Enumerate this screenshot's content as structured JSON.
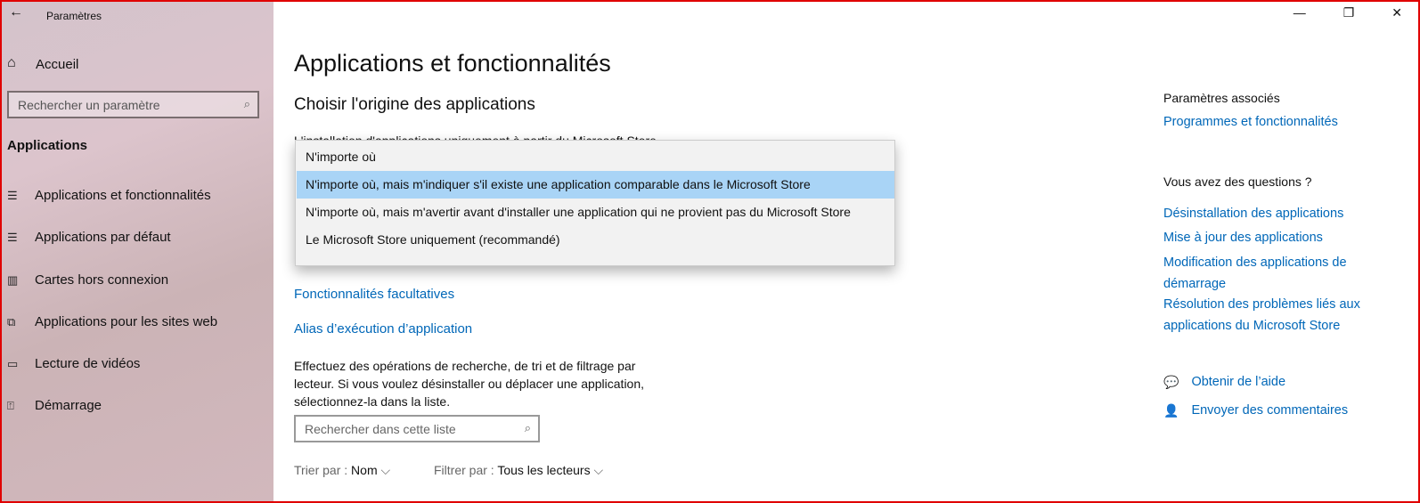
{
  "window": {
    "title": "Paramètres",
    "minimize": "—",
    "restore": "❐",
    "close": "✕"
  },
  "sidebar": {
    "home": "Accueil",
    "search_placeholder": "Rechercher un paramètre",
    "section": "Applications",
    "items": [
      {
        "label": "Applications et fonctionnalités",
        "icon": "apps-features-icon"
      },
      {
        "label": "Applications par défaut",
        "icon": "default-apps-icon"
      },
      {
        "label": "Cartes hors connexion",
        "icon": "offline-maps-icon"
      },
      {
        "label": "Applications pour les sites web",
        "icon": "apps-websites-icon"
      },
      {
        "label": "Lecture de vidéos",
        "icon": "video-playback-icon"
      },
      {
        "label": "Démarrage",
        "icon": "startup-icon"
      }
    ]
  },
  "main": {
    "title": "Applications et fonctionnalités",
    "subtitle": "Choisir l'origine des applications",
    "hidden_text": "L'installation d'applications uniquement à partir du Microsoft Store",
    "dropdown": {
      "options": [
        "N'importe où",
        "N'importe où, mais m'indiquer s'il existe une application comparable dans le Microsoft Store",
        "N'importe où, mais m'avertir avant d'installer une application qui ne provient pas du Microsoft Store",
        "Le Microsoft Store uniquement (recommandé)"
      ],
      "highlighted_index": 1
    },
    "links": [
      "Fonctionnalités facultatives",
      "Alias d’exécution d’application"
    ],
    "description": "Effectuez des opérations de recherche, de tri et de filtrage par lecteur. Si vous voulez désinstaller ou déplacer une application, sélectionnez-la dans la liste.",
    "list_search_placeholder": "Rechercher dans cette liste",
    "sort_label": "Trier par :",
    "sort_value": "Nom",
    "filter_label": "Filtrer par :",
    "filter_value": "Tous les lecteurs"
  },
  "related": {
    "heading": "Paramètres associés",
    "link": "Programmes et fonctionnalités",
    "questions_heading": "Vous avez des questions ?",
    "question_links": [
      "Désinstallation des applications",
      "Mise à jour des applications",
      "Modification des applications de démarrage",
      "Résolution des problèmes liés aux applications du Microsoft Store"
    ],
    "help": "Obtenir de l’aide",
    "feedback": "Envoyer des commentaires"
  },
  "colors": {
    "accent": "#0067b8",
    "highlight": "#a9d4f6",
    "frame": "#e00000"
  }
}
